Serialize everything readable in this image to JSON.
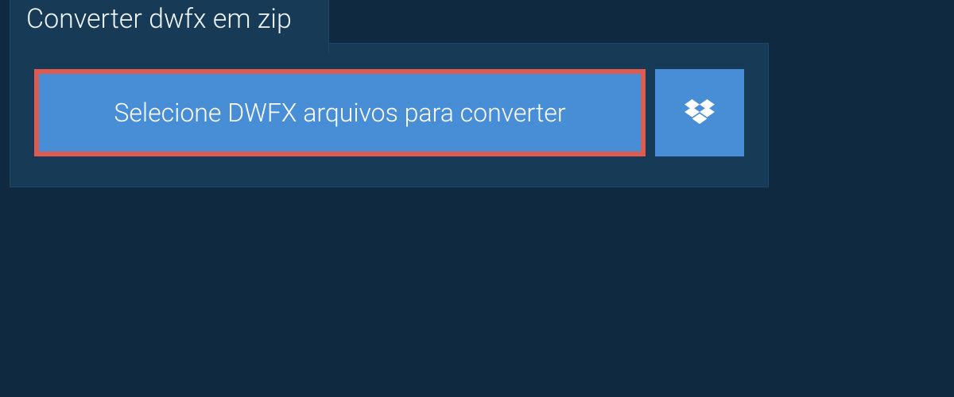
{
  "header": {
    "title": "Converter dwfx em zip"
  },
  "actions": {
    "select_files_label": "Selecione DWFX arquivos para converter"
  },
  "colors": {
    "page_bg": "#0f2940",
    "panel_bg": "#173a56",
    "button_bg": "#478ed6",
    "button_border": "#e05b4f",
    "text_light": "#ffffff"
  }
}
